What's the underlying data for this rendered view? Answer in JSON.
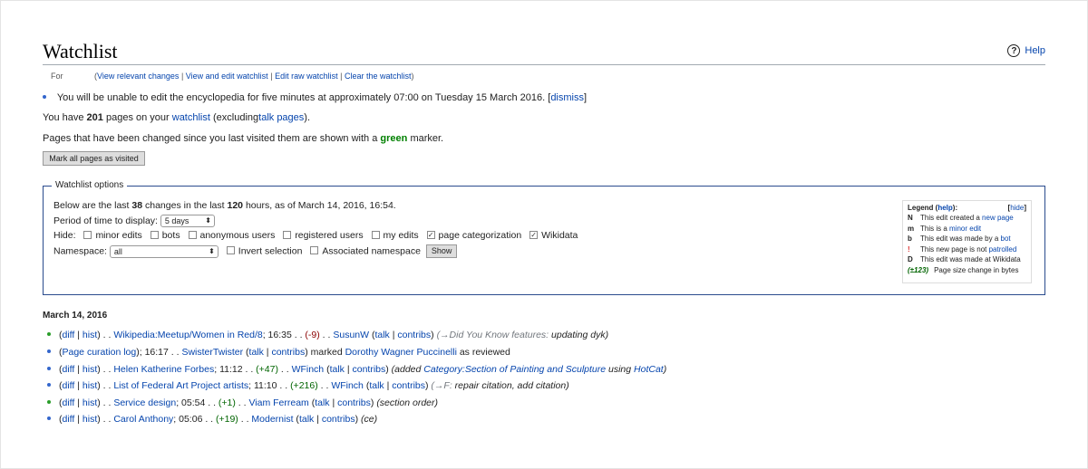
{
  "page": {
    "title": "Watchlist",
    "help_label": "Help",
    "help_icon": "?"
  },
  "subnav": {
    "for_label": "For",
    "open_paren": "(",
    "close_paren": ")",
    "links": [
      "View relevant changes",
      "View and edit watchlist",
      "Edit raw watchlist",
      "Clear the watchlist"
    ]
  },
  "notice": {
    "text": "You will be unable to edit the encyclopedia for five minutes at approximately 07:00 on Tuesday 15 March 2016.",
    "dismiss": "dismiss"
  },
  "info": {
    "count_prefix": "You have",
    "count": "201",
    "count_mid": "pages on your",
    "watchlist_link": "watchlist",
    "count_mid2": "(excluding",
    "talk_link": "talk pages",
    "count_end": ").",
    "changed_prefix": "Pages that have been changed since you last visited them are shown with a",
    "changed_color": "green",
    "changed_suffix": "marker."
  },
  "mark_button": "Mark all pages as visited",
  "options": {
    "legend": "Watchlist options",
    "summary_prefix": "Below are the last",
    "changes": "38",
    "summary_mid": "changes in the last",
    "hours": "120",
    "summary_end": "hours, as of March 14, 2016, 16:54.",
    "period_label": "Period of time to display:",
    "period_value": "5 days",
    "hide_label": "Hide:",
    "hide_options": [
      {
        "label": "minor edits",
        "checked": false
      },
      {
        "label": "bots",
        "checked": false
      },
      {
        "label": "anonymous users",
        "checked": false
      },
      {
        "label": "registered users",
        "checked": false
      },
      {
        "label": "my edits",
        "checked": false
      },
      {
        "label": "page categorization",
        "checked": true
      },
      {
        "label": "Wikidata",
        "checked": true
      }
    ],
    "namespace_label": "Namespace:",
    "namespace_value": "all",
    "invert_label": "Invert selection",
    "associated_label": "Associated namespace",
    "show_button": "Show"
  },
  "legend_box": {
    "title": "Legend",
    "help": "help",
    "hide": "hide",
    "rows": [
      {
        "sym": "N",
        "text": "This edit created a",
        "link": "new page"
      },
      {
        "sym": "m",
        "text": "This is a",
        "link": "minor edit"
      },
      {
        "sym": "b",
        "text": "This edit was made by a",
        "link": "bot"
      },
      {
        "sym": "!",
        "text": "This new page is not",
        "link": "patrolled"
      },
      {
        "sym": "D",
        "text": "This edit was made at Wikidata",
        "link": ""
      },
      {
        "sym": "(±123)",
        "text": "Page size change in bytes",
        "link": ""
      }
    ]
  },
  "changes": {
    "date": "March 14, 2016",
    "items": [
      {
        "bullet": "green",
        "prefix": "(diff | hist) . . ",
        "page": "Wikipedia:Meetup/Women in Red/8",
        "time": "; 16:35 . . ",
        "size": "(-9)",
        "size_sign": "neg",
        "user": "SusunW",
        "summary_arrow": "(→Did You Know features:",
        "summary": " updating dyk)"
      },
      {
        "bullet": "blue",
        "prefix": "(",
        "page": "Page curation log",
        "time": "); 16:17 . . ",
        "size": "",
        "size_sign": "",
        "user": "SwisterTwister",
        "summary_arrow": "",
        "summary": "marked Dorothy Wagner Puccinelli as reviewed"
      },
      {
        "bullet": "blue",
        "prefix": "(diff | hist) . . ",
        "page": "Helen Katherine Forbes",
        "time": "; 11:12 . . ",
        "size": "(+47)",
        "size_sign": "pos",
        "user": "WFinch",
        "summary_arrow": "(added",
        "summary": " Category:Section of Painting and Sculpture using HotCat)"
      },
      {
        "bullet": "blue",
        "prefix": "(diff | hist) . . ",
        "page": "List of Federal Art Project artists",
        "time": "; 11:10 . . ",
        "size": "(+216)",
        "size_sign": "pos",
        "user": "WFinch",
        "summary_arrow": "(→F:",
        "summary": " repair citation, add citation)"
      },
      {
        "bullet": "green",
        "prefix": "(diff | hist) . . ",
        "page": "Service design",
        "time": "; 05:54 . . ",
        "size": "(+1)",
        "size_sign": "pos",
        "user": "Viam Ferream",
        "summary_arrow": "",
        "summary": "(section order)"
      },
      {
        "bullet": "blue",
        "prefix": "(diff | hist) . . ",
        "page": "Carol Anthony",
        "time": "; 05:06 . . ",
        "size": "(+19)",
        "size_sign": "pos",
        "user": "Modernist",
        "summary_arrow": "",
        "summary": "(ce)"
      }
    ]
  }
}
